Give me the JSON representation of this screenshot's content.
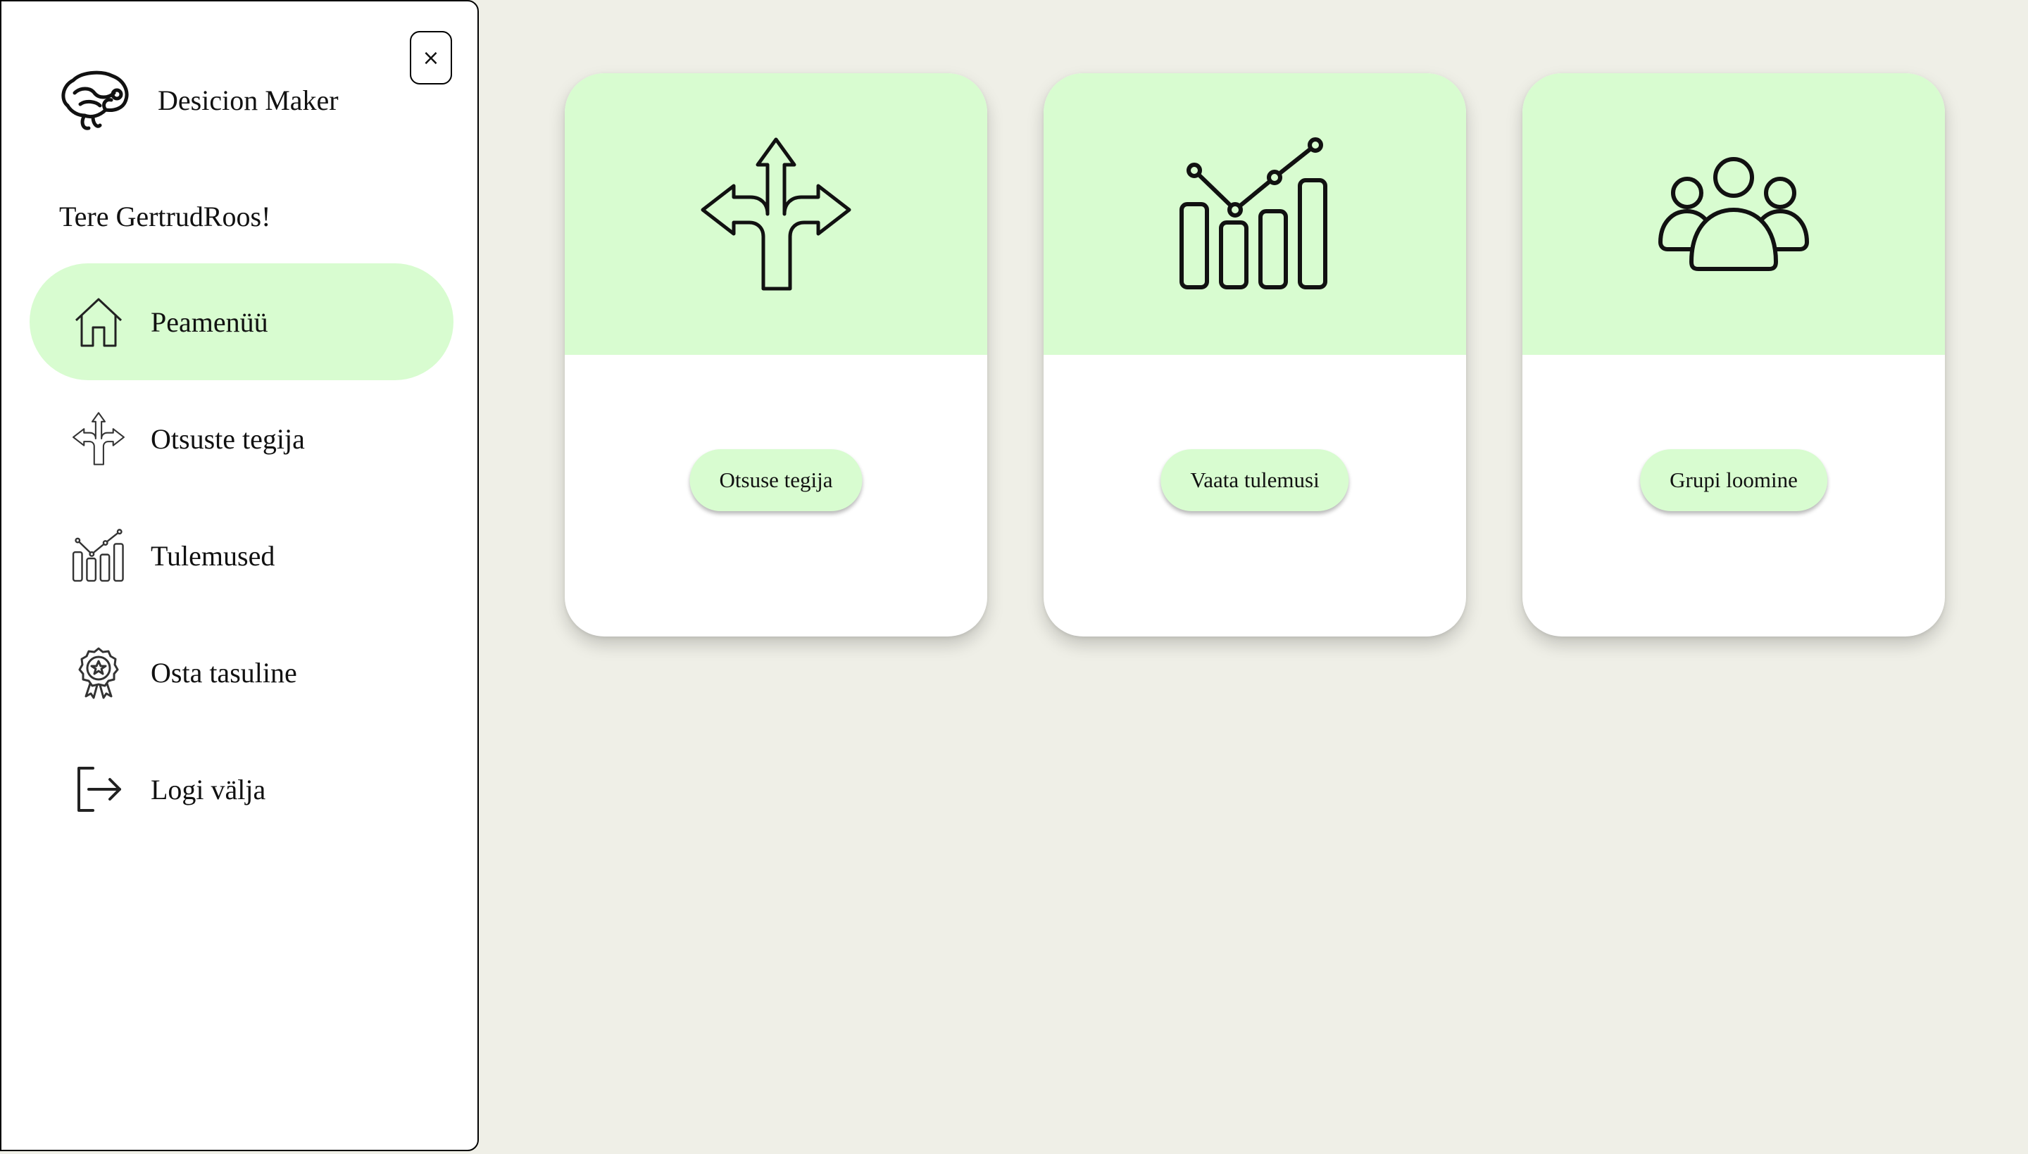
{
  "app": {
    "brand_name": "Desicion Maker",
    "greeting": "Tere GertrudRoos!",
    "close_label": "×"
  },
  "sidebar": {
    "items": [
      {
        "label": "Peamenüü",
        "icon": "home-icon",
        "active": true
      },
      {
        "label": "Otsuste tegija",
        "icon": "split-arrows-icon",
        "active": false
      },
      {
        "label": "Tulemused",
        "icon": "bar-chart-icon",
        "active": false
      },
      {
        "label": "Osta tasuline",
        "icon": "award-badge-icon",
        "active": false
      },
      {
        "label": "Logi välja",
        "icon": "logout-icon",
        "active": false
      }
    ]
  },
  "cards": [
    {
      "button_label": "Otsuse tegija",
      "icon": "split-arrows-icon"
    },
    {
      "button_label": "Vaata tulemusi",
      "icon": "bar-chart-icon"
    },
    {
      "button_label": "Grupi loomine",
      "icon": "group-users-icon"
    }
  ],
  "colors": {
    "accent": "#d8fcd0",
    "background": "#efefe7",
    "panel": "#ffffff",
    "text": "#111111"
  }
}
